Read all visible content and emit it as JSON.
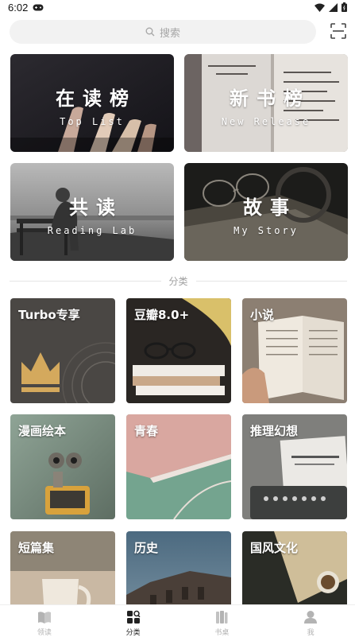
{
  "status_bar": {
    "time": "6:02"
  },
  "search": {
    "placeholder": "搜索"
  },
  "features": [
    {
      "title": "在读榜",
      "subtitle": "Top List"
    },
    {
      "title": "新书榜",
      "subtitle": "New Release"
    },
    {
      "title": "共读",
      "subtitle": "Reading Lab"
    },
    {
      "title": "故事",
      "subtitle": "My Story"
    }
  ],
  "section": {
    "label": "分类"
  },
  "categories": [
    {
      "label": "Turbo专享"
    },
    {
      "label": "豆瓣8.0+"
    },
    {
      "label": "小说"
    },
    {
      "label": "漫画绘本"
    },
    {
      "label": "青春"
    },
    {
      "label": "推理幻想"
    },
    {
      "label": "短篇集"
    },
    {
      "label": "历史"
    },
    {
      "label": "国风文化"
    }
  ],
  "tabs": [
    {
      "label": "领读",
      "icon": "book-icon"
    },
    {
      "label": "分类",
      "icon": "category-grid-icon"
    },
    {
      "label": "书桌",
      "icon": "bookshelf-icon"
    },
    {
      "label": "我",
      "icon": "person-icon"
    }
  ],
  "colors": {
    "active_tab": "#222222",
    "inactive_tab": "#b3b3b3",
    "search_bg": "#f2f2f2"
  }
}
